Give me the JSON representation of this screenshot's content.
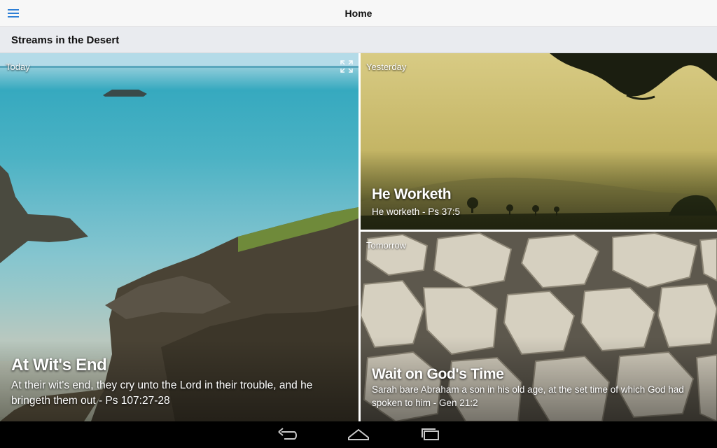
{
  "appbar": {
    "title": "Home",
    "menu_icon": "hamburger-menu-icon",
    "accent": "#2d7fd6"
  },
  "subheader": {
    "title": "Streams in the Desert"
  },
  "cards": {
    "today": {
      "day": "Today",
      "title": "At Wit's End",
      "subtitle": "At their wit's end, they cry unto the Lord in their trouble, and he bringeth them out - Ps 107:27-28",
      "icon": "fullscreen-expand-icon"
    },
    "yesterday": {
      "day": "Yesterday",
      "title": "He Worketh",
      "subtitle": "He worketh - Ps 37:5"
    },
    "tomorrow": {
      "day": "Tomorrow",
      "title": "Wait on God's Time",
      "subtitle": "Sarah bare Abraham a son in his old age, at the set time of which God had spoken to him - Gen 21:2"
    }
  },
  "navbar": {
    "back_icon": "back-icon",
    "home_icon": "home-icon",
    "recents_icon": "recent-apps-icon"
  }
}
